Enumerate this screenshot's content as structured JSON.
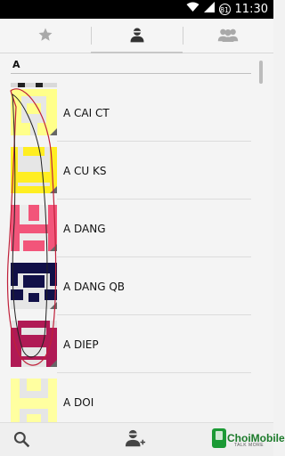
{
  "status_bar": {
    "battery": "81",
    "time": "11:30"
  },
  "tabs": [
    {
      "icon": "star-icon",
      "selected": false
    },
    {
      "icon": "person-icon",
      "selected": true
    },
    {
      "icon": "group-icon",
      "selected": false
    }
  ],
  "contacts": {
    "section_letter": "A",
    "items": [
      {
        "name": "A CAI CT",
        "avatar_color": "#ffff8a"
      },
      {
        "name": "A CU KS",
        "avatar_color": "#ffee22"
      },
      {
        "name": "A DANG",
        "avatar_color": "#f2557a"
      },
      {
        "name": "A DANG QB",
        "avatar_color": "#111048"
      },
      {
        "name": "A DIEP",
        "avatar_color": "#b01a55"
      },
      {
        "name": "A DOI",
        "avatar_color": "#ffffa0"
      }
    ]
  },
  "bottom_bar": {
    "search_icon": "search-icon",
    "add_contact_icon": "add-contact-icon",
    "logo_text": "ChoiMobile",
    "logo_tagline": "TALK MORE"
  }
}
